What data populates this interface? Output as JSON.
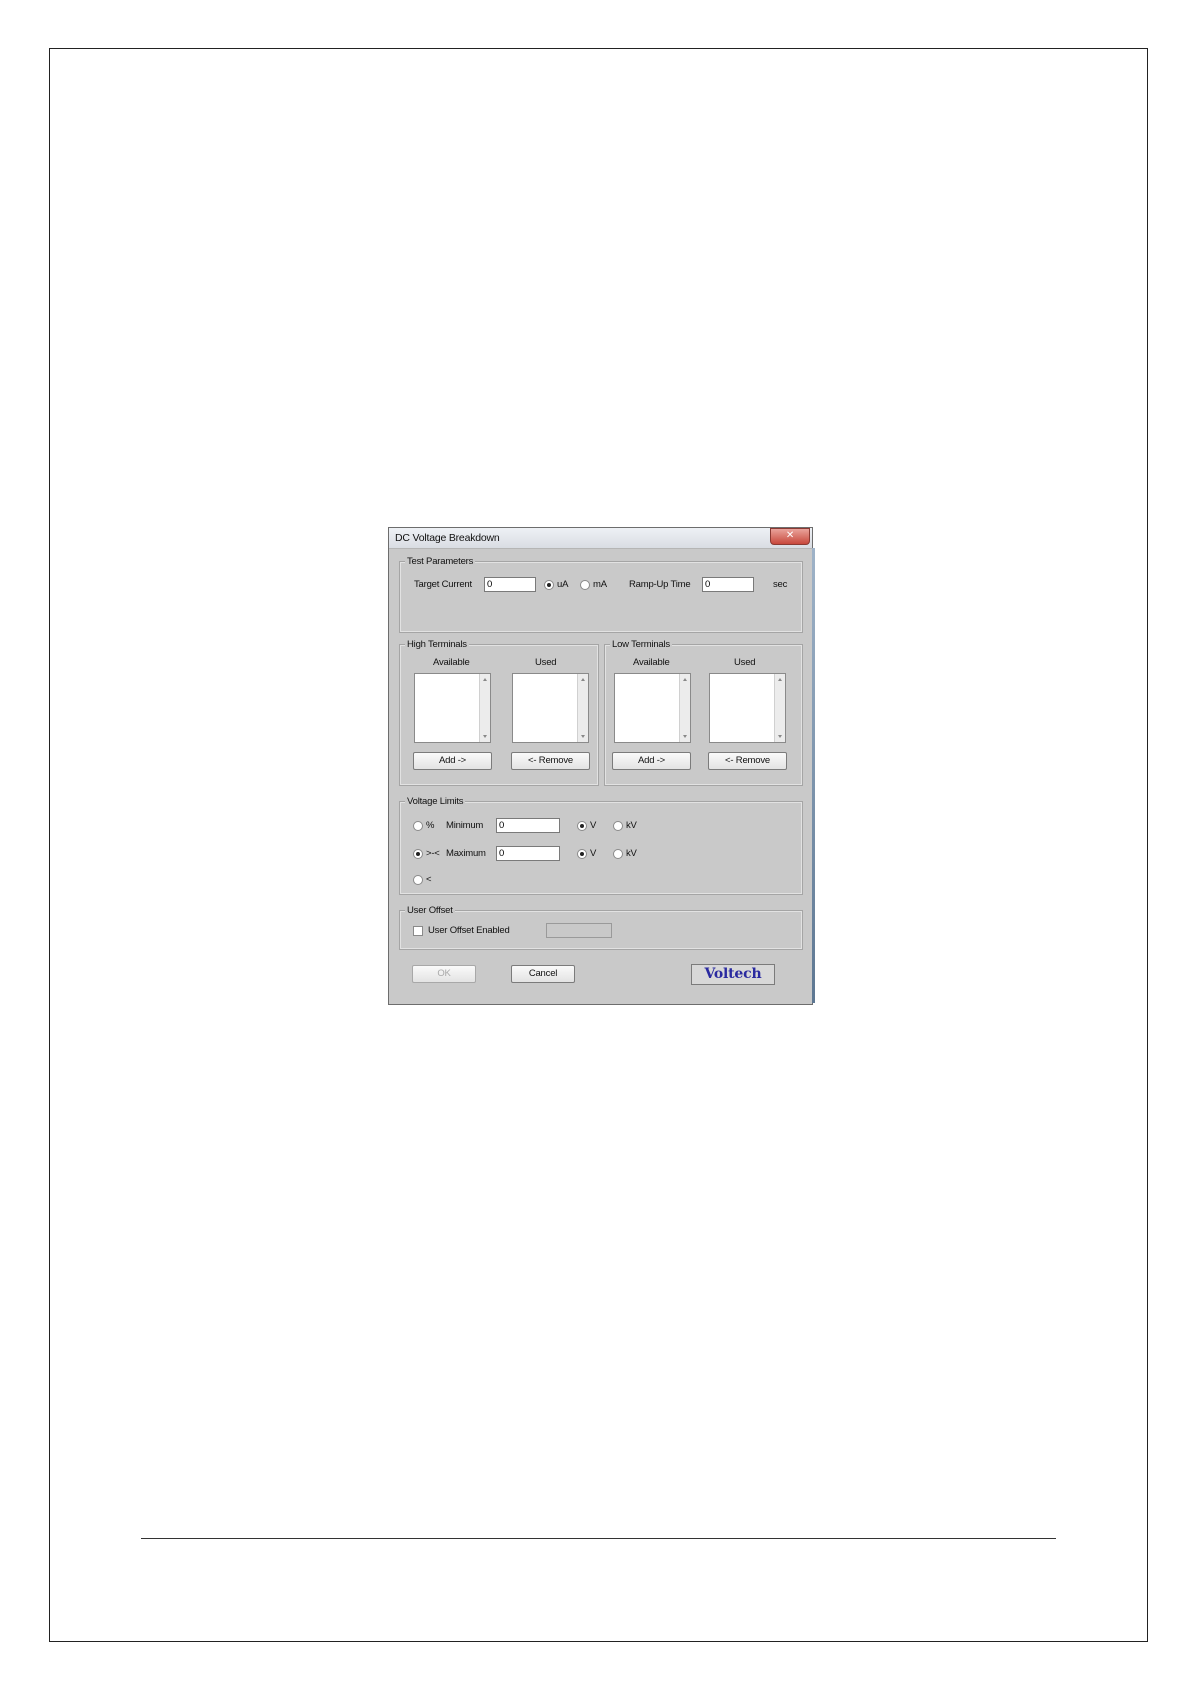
{
  "dialog": {
    "title": "DC Voltage Breakdown",
    "close_symbol": "✕"
  },
  "test_parameters": {
    "group_label": "Test Parameters",
    "target_current_label": "Target Current",
    "target_current_value": "0",
    "unit_ua": "uA",
    "unit_ma": "mA",
    "unit_selected": "uA",
    "ramp_up_label": "Ramp-Up Time",
    "ramp_up_value": "0",
    "ramp_up_unit": "sec"
  },
  "high_terminals": {
    "group_label": "High Terminals",
    "available_label": "Available",
    "used_label": "Used",
    "available_items": [],
    "used_items": [],
    "add_label": "Add ->",
    "remove_label": "<- Remove"
  },
  "low_terminals": {
    "group_label": "Low Terminals",
    "available_label": "Available",
    "used_label": "Used",
    "available_items": [],
    "used_items": [],
    "add_label": "Add ->",
    "remove_label": "<- Remove"
  },
  "voltage_limits": {
    "group_label": "Voltage Limits",
    "mode_percent": "%",
    "mode_range": ">-<",
    "mode_less": "<",
    "mode_selected": ">-<",
    "minimum_label": "Minimum",
    "minimum_value": "0",
    "maximum_label": "Maximum",
    "maximum_value": "0",
    "unit_v": "V",
    "unit_kv": "kV",
    "min_unit_selected": "V",
    "max_unit_selected": "V"
  },
  "user_offset": {
    "group_label": "User Offset",
    "enabled_label": "User Offset Enabled",
    "enabled": false,
    "value": ""
  },
  "buttons": {
    "ok_label": "OK",
    "cancel_label": "Cancel"
  },
  "logo": {
    "text": "Voltech",
    "color": "#2a2aa0"
  }
}
